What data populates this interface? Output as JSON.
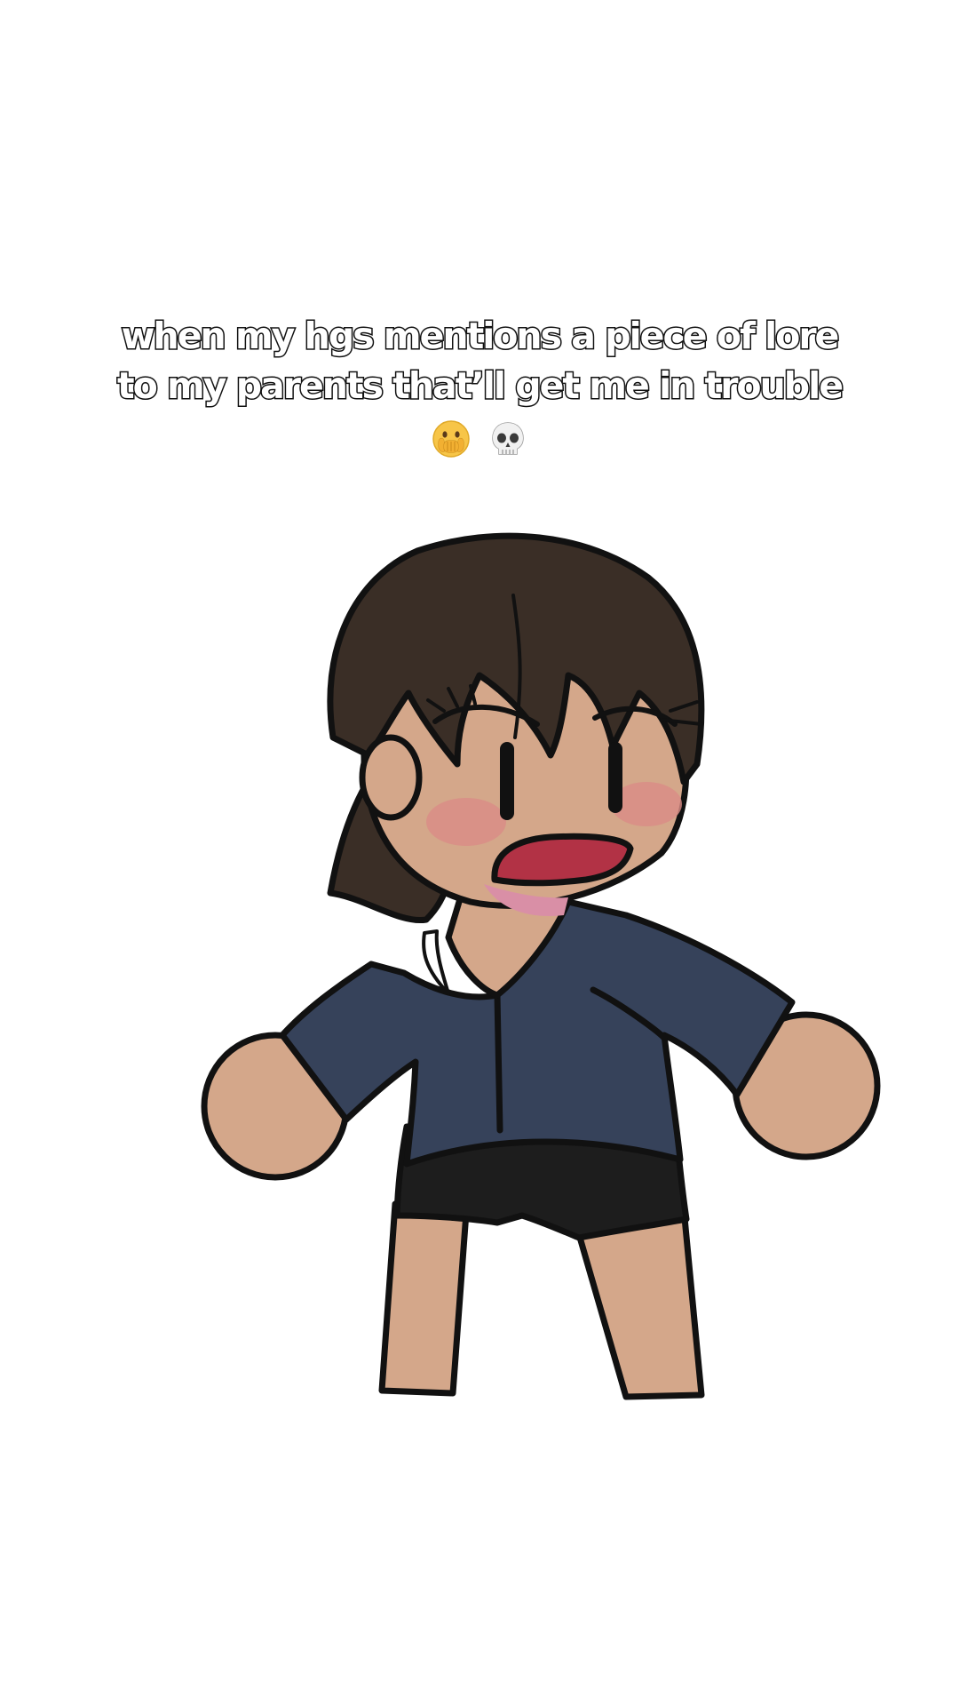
{
  "caption": {
    "line1": "when my hgs mentions a piece of lore",
    "line2": "to my parents that’ll get me in trouble",
    "emojis": [
      "face-with-open-eyes-and-hand-over-mouth",
      "skull"
    ]
  },
  "colors": {
    "background": "#ffffff",
    "hair": "#3a2e26",
    "skin": "#d4a78a",
    "shirt": "#36425a",
    "shorts": "#1d1d1d",
    "mouth": "#b23245",
    "tongue": "#d98fa6",
    "blush": "#d98c86",
    "outline": "#111111"
  }
}
